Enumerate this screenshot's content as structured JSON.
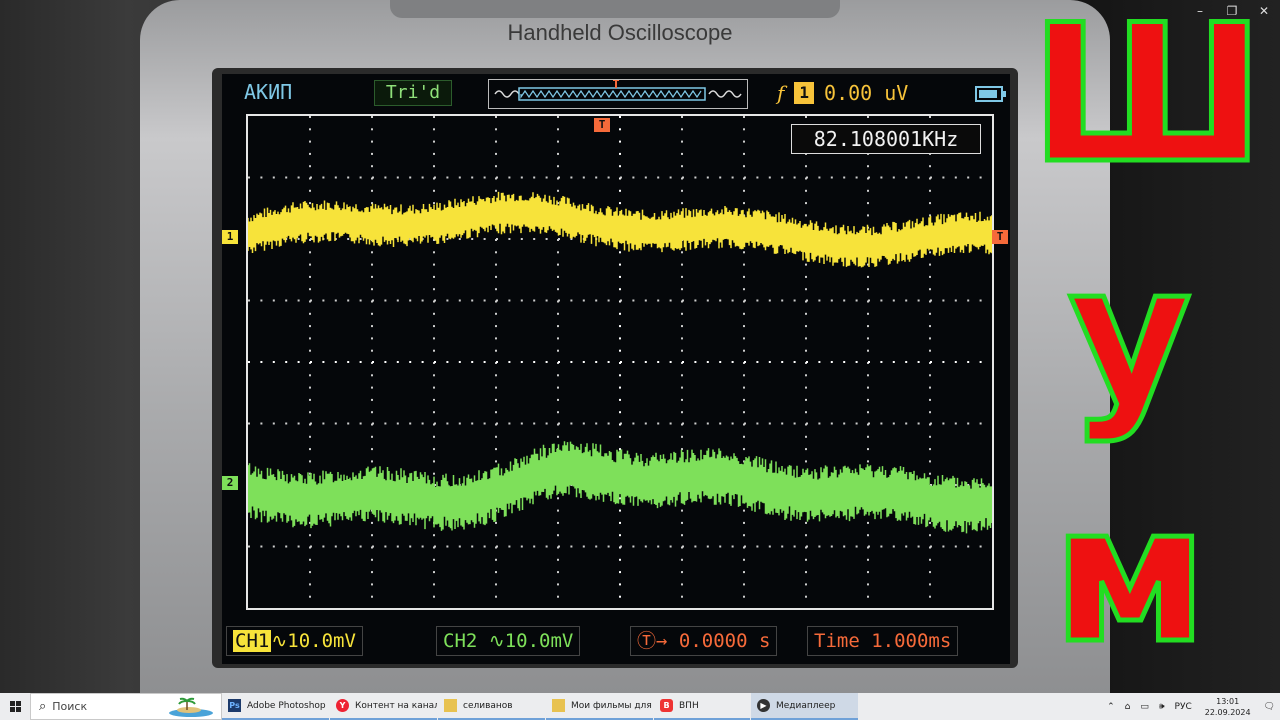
{
  "window": {
    "minimize": "–",
    "restore": "❐",
    "close": "✕"
  },
  "device": {
    "title": "Handheld Oscilloscope",
    "brand": "АКИП",
    "trigger_state": "Tri'd",
    "trigger_slope": "f",
    "trigger_source": "1",
    "trigger_level": "0.00 uV",
    "frequency": "82.108001KHz",
    "ch1_marker": "1",
    "ch2_marker": "2",
    "trigger_pos_marker": "T",
    "ch1_tag": "CH1",
    "ch1_scale": "10.0mV",
    "ch2_label": "CH2",
    "ch2_scale": "10.0mV",
    "tpos_value": "0.0000 s",
    "timebase": "Time 1.000ms",
    "colors": {
      "ch1": "#f7e33a",
      "ch2": "#7ee05a",
      "trigger": "#f66a3a",
      "grid": "#e6e6e6"
    }
  },
  "overlay": {
    "letters": [
      "Ш",
      "у",
      "м"
    ],
    "fill": "#ee1111",
    "stroke": "#22dd22"
  },
  "taskbar": {
    "search_placeholder": "Поиск",
    "apps": [
      {
        "label": "Adobe Photoshop ...",
        "icon": "photoshop-icon"
      },
      {
        "label": "Контент на канале...",
        "icon": "yandex-browser-icon"
      },
      {
        "label": "селиванов",
        "icon": "folder-icon"
      },
      {
        "label": "Мои фильмы для ...",
        "icon": "folder-icon"
      },
      {
        "label": "ВПН",
        "icon": "vpn-icon"
      },
      {
        "label": "Медиаплеер",
        "icon": "media-player-icon"
      }
    ],
    "lang": "РУС",
    "time": "13:01",
    "date": "22.09.2024"
  }
}
